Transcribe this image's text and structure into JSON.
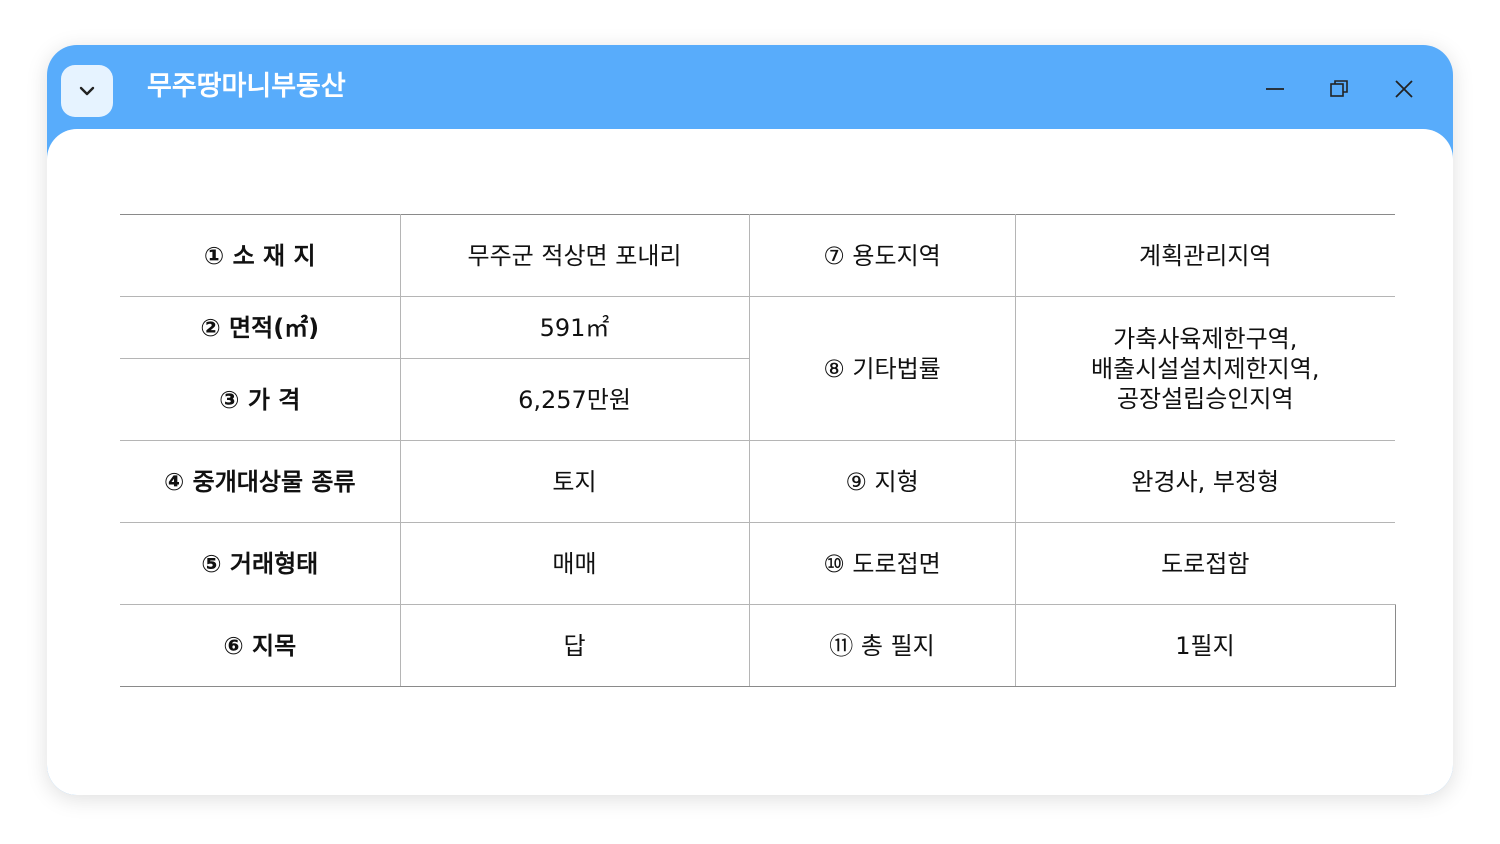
{
  "window": {
    "title": "무주땅마니부동산"
  },
  "icons": {
    "menu": "chevron-down-icon",
    "minimize": "minimize-icon",
    "maximize": "restore-icon",
    "close": "close-icon"
  },
  "colors": {
    "titlebar": "#58acfb",
    "menu_button_bg": "#e6f3ff"
  },
  "table": {
    "location_label": "① 소 재 지",
    "location_value": "무주군 적상면 포내리",
    "zoning_label": "⑦ 용도지역",
    "zoning_value": "계획관리지역",
    "area_label": "② 면적(㎡)",
    "area_value": "591㎡",
    "other_laws_label": "⑧ 기타법률",
    "other_laws_lines": [
      "가축사육제한구역,",
      "배출시설설치제한지역,",
      "공장설립승인지역"
    ],
    "price_label": "③ 가 격",
    "price_value": "6,257만원",
    "property_type_label": "④ 중개대상물 종류",
    "property_type_value": "토지",
    "terrain_label": "⑨ 지형",
    "terrain_value": "완경사, 부정형",
    "deal_type_label": "⑤ 거래형태",
    "deal_type_value": "매매",
    "road_label": "⑩ 도로접면",
    "road_value": "도로접함",
    "land_category_label": "⑥  지목",
    "land_category_value": "답",
    "parcels_label": "⑪ 총 필지",
    "parcels_value": "1필지"
  }
}
